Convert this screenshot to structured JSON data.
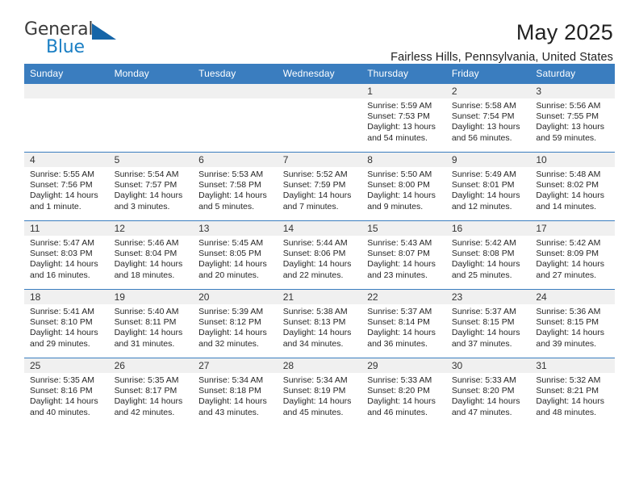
{
  "brand": {
    "line1": "General",
    "line2": "Blue",
    "triangle_icon": "blue-triangle-icon",
    "color_dark": "#3b3b3b",
    "color_blue": "#1b7fc4"
  },
  "header": {
    "title": "May 2025",
    "subtitle": "Fairless Hills, Pennsylvania, United States"
  },
  "theme": {
    "header_blue": "#3a7dbf",
    "daynum_band": "#f0f0f0",
    "text": "#262626"
  },
  "weekdays": [
    "Sunday",
    "Monday",
    "Tuesday",
    "Wednesday",
    "Thursday",
    "Friday",
    "Saturday"
  ],
  "weeks": [
    [
      {
        "day": "",
        "lines": []
      },
      {
        "day": "",
        "lines": []
      },
      {
        "day": "",
        "lines": []
      },
      {
        "day": "",
        "lines": []
      },
      {
        "day": "1",
        "lines": [
          "Sunrise: 5:59 AM",
          "Sunset: 7:53 PM",
          "Daylight: 13 hours and 54 minutes."
        ]
      },
      {
        "day": "2",
        "lines": [
          "Sunrise: 5:58 AM",
          "Sunset: 7:54 PM",
          "Daylight: 13 hours and 56 minutes."
        ]
      },
      {
        "day": "3",
        "lines": [
          "Sunrise: 5:56 AM",
          "Sunset: 7:55 PM",
          "Daylight: 13 hours and 59 minutes."
        ]
      }
    ],
    [
      {
        "day": "4",
        "lines": [
          "Sunrise: 5:55 AM",
          "Sunset: 7:56 PM",
          "Daylight: 14 hours and 1 minute."
        ]
      },
      {
        "day": "5",
        "lines": [
          "Sunrise: 5:54 AM",
          "Sunset: 7:57 PM",
          "Daylight: 14 hours and 3 minutes."
        ]
      },
      {
        "day": "6",
        "lines": [
          "Sunrise: 5:53 AM",
          "Sunset: 7:58 PM",
          "Daylight: 14 hours and 5 minutes."
        ]
      },
      {
        "day": "7",
        "lines": [
          "Sunrise: 5:52 AM",
          "Sunset: 7:59 PM",
          "Daylight: 14 hours and 7 minutes."
        ]
      },
      {
        "day": "8",
        "lines": [
          "Sunrise: 5:50 AM",
          "Sunset: 8:00 PM",
          "Daylight: 14 hours and 9 minutes."
        ]
      },
      {
        "day": "9",
        "lines": [
          "Sunrise: 5:49 AM",
          "Sunset: 8:01 PM",
          "Daylight: 14 hours and 12 minutes."
        ]
      },
      {
        "day": "10",
        "lines": [
          "Sunrise: 5:48 AM",
          "Sunset: 8:02 PM",
          "Daylight: 14 hours and 14 minutes."
        ]
      }
    ],
    [
      {
        "day": "11",
        "lines": [
          "Sunrise: 5:47 AM",
          "Sunset: 8:03 PM",
          "Daylight: 14 hours and 16 minutes."
        ]
      },
      {
        "day": "12",
        "lines": [
          "Sunrise: 5:46 AM",
          "Sunset: 8:04 PM",
          "Daylight: 14 hours and 18 minutes."
        ]
      },
      {
        "day": "13",
        "lines": [
          "Sunrise: 5:45 AM",
          "Sunset: 8:05 PM",
          "Daylight: 14 hours and 20 minutes."
        ]
      },
      {
        "day": "14",
        "lines": [
          "Sunrise: 5:44 AM",
          "Sunset: 8:06 PM",
          "Daylight: 14 hours and 22 minutes."
        ]
      },
      {
        "day": "15",
        "lines": [
          "Sunrise: 5:43 AM",
          "Sunset: 8:07 PM",
          "Daylight: 14 hours and 23 minutes."
        ]
      },
      {
        "day": "16",
        "lines": [
          "Sunrise: 5:42 AM",
          "Sunset: 8:08 PM",
          "Daylight: 14 hours and 25 minutes."
        ]
      },
      {
        "day": "17",
        "lines": [
          "Sunrise: 5:42 AM",
          "Sunset: 8:09 PM",
          "Daylight: 14 hours and 27 minutes."
        ]
      }
    ],
    [
      {
        "day": "18",
        "lines": [
          "Sunrise: 5:41 AM",
          "Sunset: 8:10 PM",
          "Daylight: 14 hours and 29 minutes."
        ]
      },
      {
        "day": "19",
        "lines": [
          "Sunrise: 5:40 AM",
          "Sunset: 8:11 PM",
          "Daylight: 14 hours and 31 minutes."
        ]
      },
      {
        "day": "20",
        "lines": [
          "Sunrise: 5:39 AM",
          "Sunset: 8:12 PM",
          "Daylight: 14 hours and 32 minutes."
        ]
      },
      {
        "day": "21",
        "lines": [
          "Sunrise: 5:38 AM",
          "Sunset: 8:13 PM",
          "Daylight: 14 hours and 34 minutes."
        ]
      },
      {
        "day": "22",
        "lines": [
          "Sunrise: 5:37 AM",
          "Sunset: 8:14 PM",
          "Daylight: 14 hours and 36 minutes."
        ]
      },
      {
        "day": "23",
        "lines": [
          "Sunrise: 5:37 AM",
          "Sunset: 8:15 PM",
          "Daylight: 14 hours and 37 minutes."
        ]
      },
      {
        "day": "24",
        "lines": [
          "Sunrise: 5:36 AM",
          "Sunset: 8:15 PM",
          "Daylight: 14 hours and 39 minutes."
        ]
      }
    ],
    [
      {
        "day": "25",
        "lines": [
          "Sunrise: 5:35 AM",
          "Sunset: 8:16 PM",
          "Daylight: 14 hours and 40 minutes."
        ]
      },
      {
        "day": "26",
        "lines": [
          "Sunrise: 5:35 AM",
          "Sunset: 8:17 PM",
          "Daylight: 14 hours and 42 minutes."
        ]
      },
      {
        "day": "27",
        "lines": [
          "Sunrise: 5:34 AM",
          "Sunset: 8:18 PM",
          "Daylight: 14 hours and 43 minutes."
        ]
      },
      {
        "day": "28",
        "lines": [
          "Sunrise: 5:34 AM",
          "Sunset: 8:19 PM",
          "Daylight: 14 hours and 45 minutes."
        ]
      },
      {
        "day": "29",
        "lines": [
          "Sunrise: 5:33 AM",
          "Sunset: 8:20 PM",
          "Daylight: 14 hours and 46 minutes."
        ]
      },
      {
        "day": "30",
        "lines": [
          "Sunrise: 5:33 AM",
          "Sunset: 8:20 PM",
          "Daylight: 14 hours and 47 minutes."
        ]
      },
      {
        "day": "31",
        "lines": [
          "Sunrise: 5:32 AM",
          "Sunset: 8:21 PM",
          "Daylight: 14 hours and 48 minutes."
        ]
      }
    ]
  ]
}
